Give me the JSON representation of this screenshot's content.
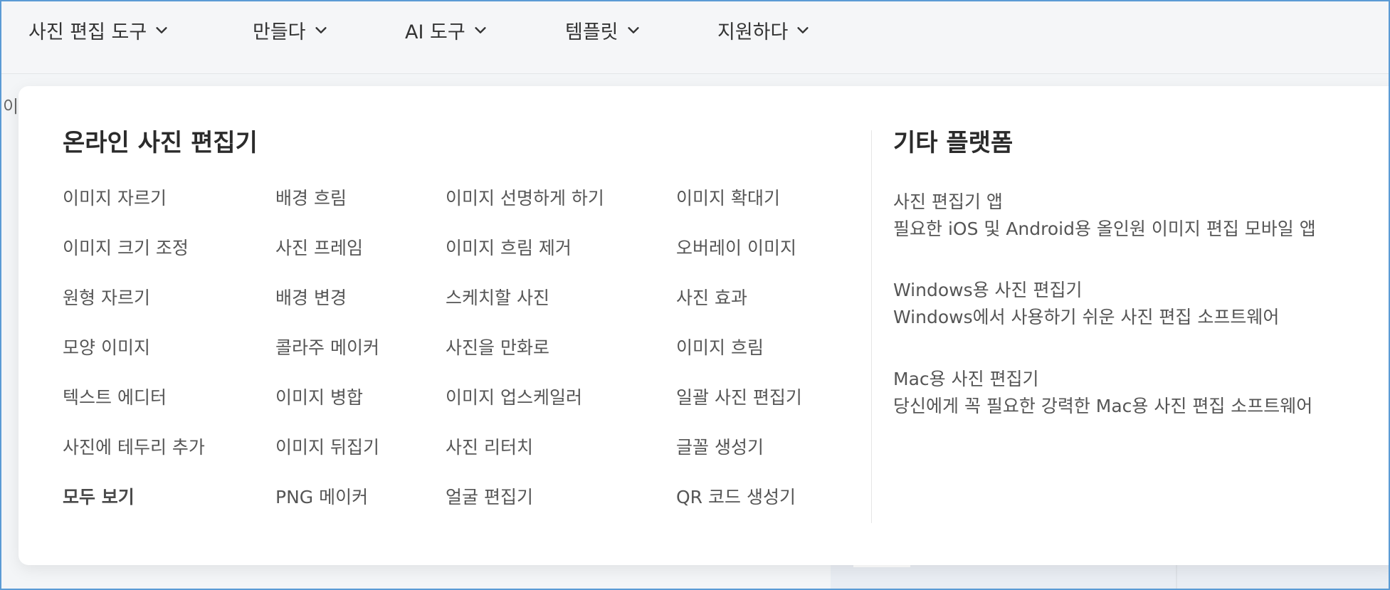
{
  "nav": {
    "items": [
      {
        "label": "사진 편집 도구"
      },
      {
        "label": "만들다"
      },
      {
        "label": "AI 도구"
      },
      {
        "label": "템플릿"
      },
      {
        "label": "지원하다"
      }
    ]
  },
  "behind": {
    "text": "이"
  },
  "panel": {
    "online_title": "온라인 사진 편집기",
    "columns": [
      [
        "이미지 자르기",
        "이미지 크기 조정",
        "원형 자르기",
        "모양 이미지",
        "텍스트 에디터",
        "사진에 테두리 추가",
        "모두 보기"
      ],
      [
        "배경 흐림",
        "사진 프레임",
        "배경 변경",
        "콜라주 메이커",
        "이미지 병합",
        "이미지 뒤집기",
        "PNG 메이커"
      ],
      [
        "이미지 선명하게 하기",
        "이미지 흐림 제거",
        "스케치할 사진",
        "사진을 만화로",
        "이미지 업스케일러",
        "사진 리터치",
        "얼굴 편집기"
      ],
      [
        "이미지 확대기",
        "오버레이 이미지",
        "사진 효과",
        "이미지 흐림",
        "일괄 사진 편집기",
        "글꼴 생성기",
        "QR 코드 생성기"
      ]
    ],
    "other_title": "기타 플랫폼",
    "platforms": [
      {
        "title": "사진 편집기 앱",
        "desc": "필요한 iOS 및 Android용 올인원 이미지 편집 모바일 앱"
      },
      {
        "title": "Windows용 사진 편집기",
        "desc": "Windows에서 사용하기 쉬운 사진 편집 소프트웨어"
      },
      {
        "title": "Mac용 사진 편집기",
        "desc": "당신에게 꼭 필요한 강력한 Mac용 사진 편집 소프트웨어"
      }
    ]
  },
  "colors": {
    "link": "#555555",
    "title": "#2b2b2b",
    "frame": "#5b9bd5"
  }
}
